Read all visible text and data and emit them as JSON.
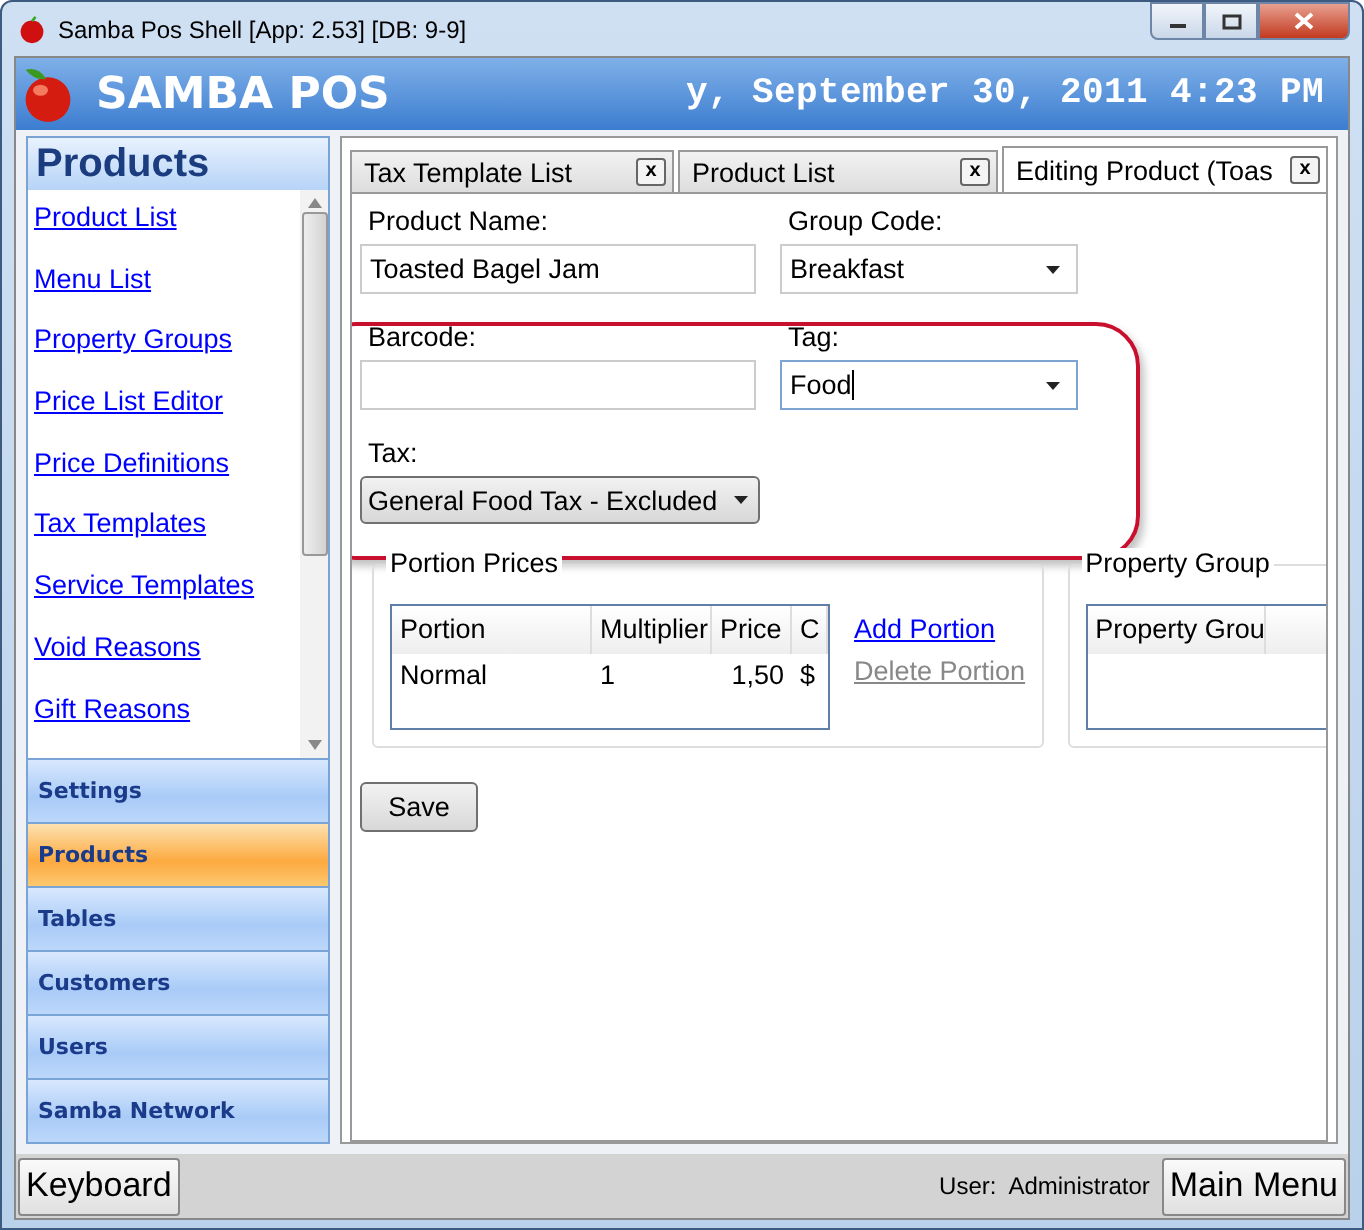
{
  "window": {
    "title": "Samba Pos Shell [App: 2.53] [DB: 9-9]"
  },
  "header": {
    "app_name": "SAMBA POS",
    "datetime": "y, September 30, 2011 4:23 PM"
  },
  "sidebar": {
    "title": "Products",
    "links": [
      "Product List",
      "Menu List",
      "Property Groups",
      "Price List Editor",
      "Price Definitions",
      "Tax Templates",
      "Service Templates",
      "Void Reasons",
      "Gift Reasons"
    ],
    "sections": [
      {
        "label": "Settings",
        "selected": false
      },
      {
        "label": "Products",
        "selected": true
      },
      {
        "label": "Tables",
        "selected": false
      },
      {
        "label": "Customers",
        "selected": false
      },
      {
        "label": "Users",
        "selected": false
      },
      {
        "label": "Samba Network",
        "selected": false
      }
    ]
  },
  "tabs": [
    {
      "label": "Tax Template List",
      "close": "x",
      "selected": false
    },
    {
      "label": "Product List",
      "close": "x",
      "selected": false
    },
    {
      "label": "Editing Product (Toas",
      "close": "x",
      "selected": true
    }
  ],
  "form": {
    "product_name": {
      "label": "Product Name:",
      "value": "Toasted Bagel Jam"
    },
    "group_code": {
      "label": "Group Code:",
      "value": "Breakfast"
    },
    "barcode": {
      "label": "Barcode:"
    },
    "tag": {
      "label": "Tag:",
      "value": "Food",
      "focused": true
    },
    "tax": {
      "label": "Tax:",
      "value": "General Food Tax - Excluded"
    }
  },
  "portion_prices": {
    "title": "Portion Prices",
    "columns": [
      "Portion",
      "Multiplier",
      "Price",
      "C"
    ],
    "rows": [
      [
        "Normal",
        "1",
        "1,50",
        "$"
      ]
    ],
    "add_link": {
      "label": "Add Portion",
      "disabled": false
    },
    "delete_link": {
      "label": "Delete Portion",
      "disabled": true
    }
  },
  "property_groups": {
    "title": "Property Group",
    "column": "Property Grou"
  },
  "save_button": "Save",
  "status_bar": {
    "keyboard": "Keyboard",
    "user_label": "User:",
    "user": "Administrator",
    "main_menu": "Main Menu"
  }
}
